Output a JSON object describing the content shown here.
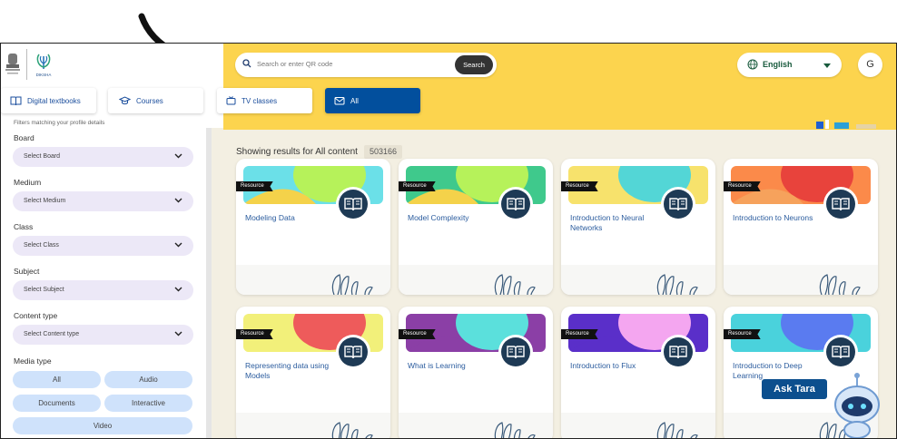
{
  "header": {
    "search_placeholder": "Search or enter QR code",
    "search_button": "Search",
    "language": "English",
    "avatar_initial": "G",
    "logo_text": "DIKSHA"
  },
  "tabs": [
    {
      "label": "Digital textbooks",
      "icon": "book-icon"
    },
    {
      "label": "Courses",
      "icon": "graduation-cap-icon"
    },
    {
      "label": "TV classes",
      "icon": "tv-icon"
    },
    {
      "label": "All",
      "icon": "envelope-icon",
      "active": true
    }
  ],
  "filters": {
    "note": "Filters matching your profile details",
    "fields": [
      {
        "label": "Board",
        "value": "Select Board"
      },
      {
        "label": "Medium",
        "value": "Select Medium"
      },
      {
        "label": "Class",
        "value": "Select Class"
      },
      {
        "label": "Subject",
        "value": "Select Subject"
      },
      {
        "label": "Content type",
        "value": "Select Content type"
      }
    ],
    "media_label": "Media type",
    "media_options": [
      "All",
      "Audio",
      "Documents",
      "Interactive",
      "Video"
    ]
  },
  "results": {
    "title": "Showing results for All content",
    "count": "503166",
    "badge": "Resource",
    "cards": [
      {
        "title": "Modeling Data",
        "colors": [
          "#6be0e8",
          "#b6f25a",
          "#f4d24a"
        ]
      },
      {
        "title": "Model Complexity",
        "colors": [
          "#3fc98c",
          "#b6f25a",
          "#f4d24a"
        ]
      },
      {
        "title": "Introduction to Neural Networks",
        "colors": [
          "#f7e26c",
          "#53d6d6",
          "#f7e26c"
        ]
      },
      {
        "title": "Introduction to Neurons",
        "colors": [
          "#fb8a4a",
          "#e8433c",
          "#f6a25c"
        ]
      },
      {
        "title": "Representing data using Models",
        "colors": [
          "#f2f07a",
          "#ee5b5b",
          "#f2f07a"
        ]
      },
      {
        "title": "What is Learning",
        "colors": [
          "#8b3fa6",
          "#5be0dc",
          "#8b3fa6"
        ]
      },
      {
        "title": "Introduction to Flux",
        "colors": [
          "#5a2fc9",
          "#f4a6f0",
          "#5a2fc9"
        ]
      },
      {
        "title": "Introduction to Deep Learning",
        "colors": [
          "#4ad2dc",
          "#5a7bf0",
          "#4ad2dc"
        ]
      }
    ]
  },
  "assistant": {
    "label": "Ask Tara"
  }
}
